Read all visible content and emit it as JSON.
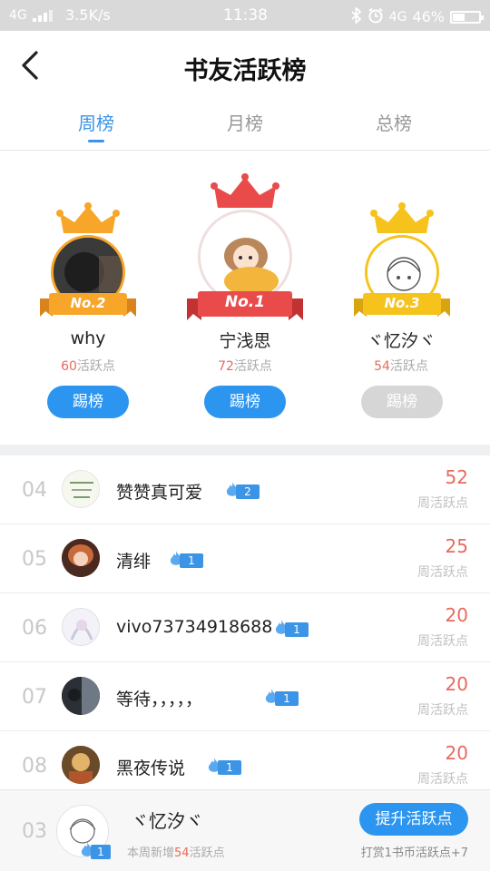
{
  "status_bar": {
    "network": "4G",
    "speed": "3.5K/s",
    "time": "11:38",
    "network_right": "4G",
    "battery": "46%",
    "battery_level": 0.46
  },
  "header": {
    "title": "书友活跃榜",
    "back_icon": "chevron-left-icon"
  },
  "tabs": [
    {
      "label": "周榜",
      "active": true
    },
    {
      "label": "月榜",
      "active": false
    },
    {
      "label": "总榜",
      "active": false
    }
  ],
  "podium": [
    {
      "rank_label": "No.2",
      "name": "why",
      "points": "60",
      "points_suffix": "活跃点",
      "button": "踢榜",
      "button_enabled": true
    },
    {
      "rank_label": "No.1",
      "name": "宁浅思",
      "points": "72",
      "points_suffix": "活跃点",
      "button": "踢榜",
      "button_enabled": true
    },
    {
      "rank_label": "No.3",
      "name": "ヾ忆汐ヾ",
      "points": "54",
      "points_suffix": "活跃点",
      "button": "踢榜",
      "button_enabled": false
    }
  ],
  "list": [
    {
      "rank": "04",
      "name": "赞赞真可爱",
      "level": "2",
      "score": "52",
      "score_label": "周活跃点"
    },
    {
      "rank": "05",
      "name": "清绯",
      "level": "1",
      "score": "25",
      "score_label": "周活跃点"
    },
    {
      "rank": "06",
      "name": "vivo73734918688",
      "level": "1",
      "score": "20",
      "score_label": "周活跃点"
    },
    {
      "rank": "07",
      "name": "等待，，，，，",
      "level": "1",
      "score": "20",
      "score_label": "周活跃点"
    },
    {
      "rank": "08",
      "name": "黑夜传说",
      "level": "1",
      "score": "20",
      "score_label": "周活跃点"
    }
  ],
  "my_rank": {
    "rank": "03",
    "name": "ヾ忆汐ヾ",
    "level": "1",
    "sub_prefix": "本周新增",
    "sub_points": "54",
    "sub_suffix": "活跃点",
    "button": "提升活跃点",
    "note": "打赏1书币活跃点+7"
  },
  "colors": {
    "accent": "#2b95f0",
    "score": "#e86a5e",
    "gold": "#f5a623",
    "red": "#e94b4b"
  }
}
